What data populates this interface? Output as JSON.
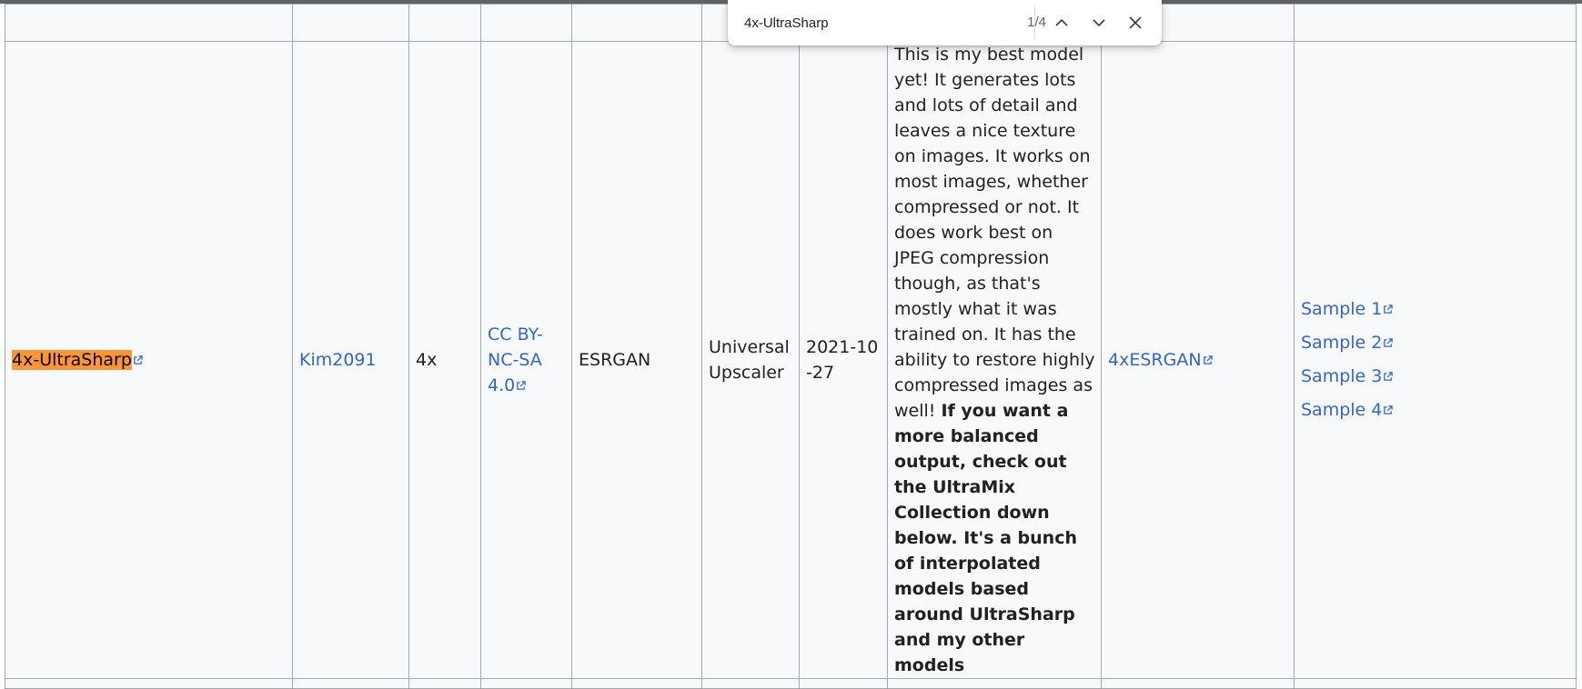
{
  "find_bar": {
    "query": "4x-UltraSharp",
    "count": "1/4"
  },
  "row": {
    "name_highlight": "4x-UltraSharp",
    "author": "Kim2091",
    "scale": "4x",
    "license": "CC BY-NC-SA 4.0",
    "architecture": "ESRGAN",
    "purpose": "Universal Upscaler",
    "date": "2021-10-27",
    "description": "This is my best model yet! It generates lots and lots of detail and leaves a nice texture on images. It works on most images, whether compressed or not. It does work best on JPEG compression though, as that's mostly what it was trained on. It has the ability to restore highly compressed images as well!",
    "description_bold": "If you want a more balanced output, check out the UltraMix Collection down below. It's a bunch of interpolated models based around UltraSharp and my other models",
    "dataset": "4xESRGAN",
    "samples": [
      "Sample 1",
      "Sample 2",
      "Sample 3",
      "Sample 4"
    ]
  },
  "colors": {
    "link": "#3366cc",
    "highlight": "#ff9632",
    "cell_bg": "#f8f9fa",
    "border": "#a2a9b1"
  },
  "icons": [
    "external-link-icon",
    "chevron-up-icon",
    "chevron-down-icon",
    "close-icon"
  ]
}
